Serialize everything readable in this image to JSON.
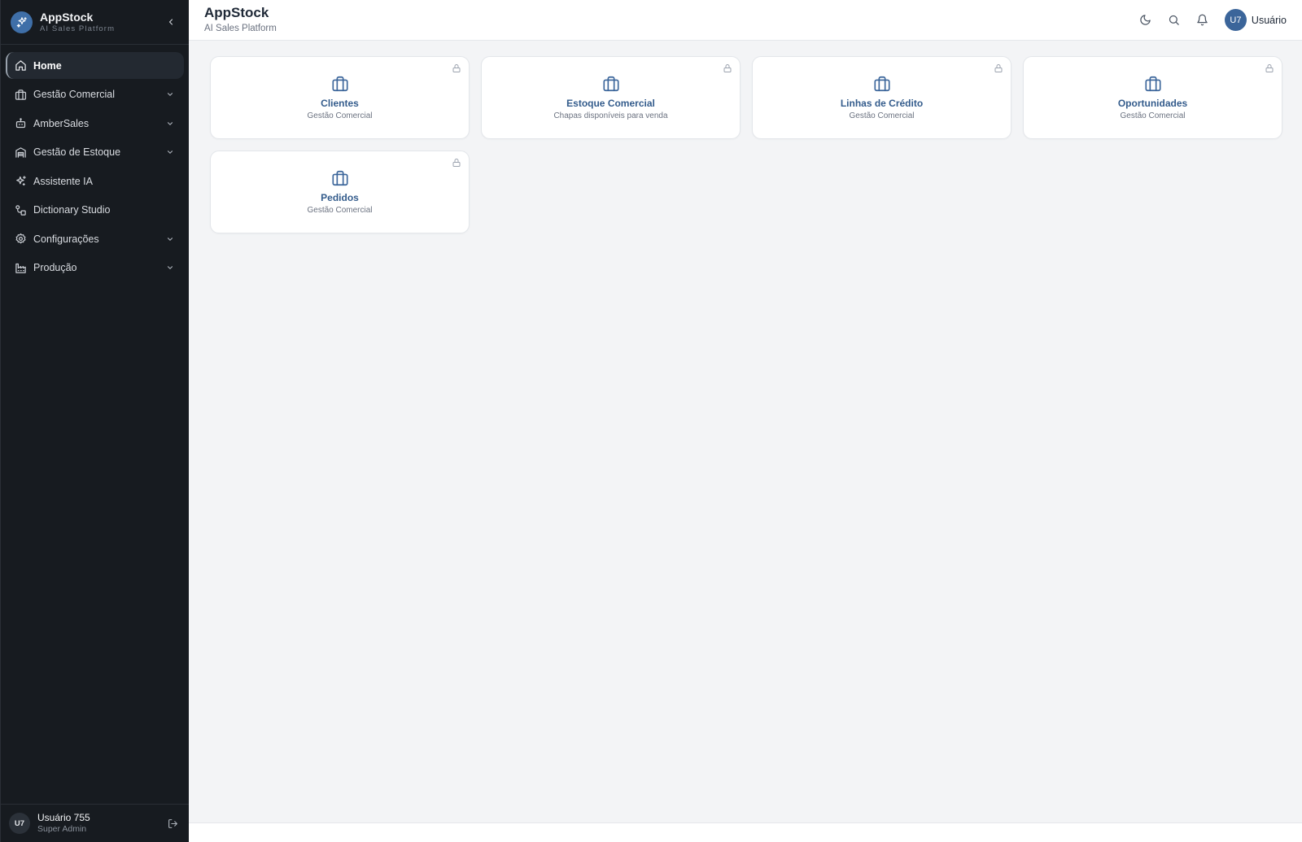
{
  "brand": {
    "title": "AppStock",
    "subtitle": "AI Sales Platform"
  },
  "header": {
    "title": "AppStock",
    "subtitle": "AI Sales Platform",
    "user_initials": "U7",
    "user_name": "Usuário"
  },
  "sidebar": {
    "items": [
      {
        "label": "Home",
        "icon": "home-icon",
        "active": true,
        "expandable": false
      },
      {
        "label": "Gestão Comercial",
        "icon": "briefcase-icon",
        "expandable": true
      },
      {
        "label": "AmberSales",
        "icon": "bot-icon",
        "expandable": true
      },
      {
        "label": "Gestão de Estoque",
        "icon": "warehouse-icon",
        "expandable": true
      },
      {
        "label": "Assistente IA",
        "icon": "sparkles-icon",
        "expandable": false
      },
      {
        "label": "Dictionary Studio",
        "icon": "workflow-icon",
        "expandable": false
      },
      {
        "label": "Configurações",
        "icon": "gear-icon",
        "expandable": true
      },
      {
        "label": "Produção",
        "icon": "factory-icon",
        "expandable": true
      }
    ],
    "footer": {
      "initials": "U7",
      "name": "Usuário 755",
      "role": "Super Admin"
    }
  },
  "cards": [
    {
      "title": "Clientes",
      "subtitle": "Gestão Comercial"
    },
    {
      "title": "Estoque Comercial",
      "subtitle": "Chapas disponíveis para venda"
    },
    {
      "title": "Linhas de Crédito",
      "subtitle": "Gestão Comercial"
    },
    {
      "title": "Oportunidades",
      "subtitle": "Gestão Comercial"
    },
    {
      "title": "Pedidos",
      "subtitle": "Gestão Comercial"
    }
  ],
  "colors": {
    "sidebar_bg": "#171b20",
    "accent": "#3b659a",
    "card_title": "#345c8c"
  }
}
